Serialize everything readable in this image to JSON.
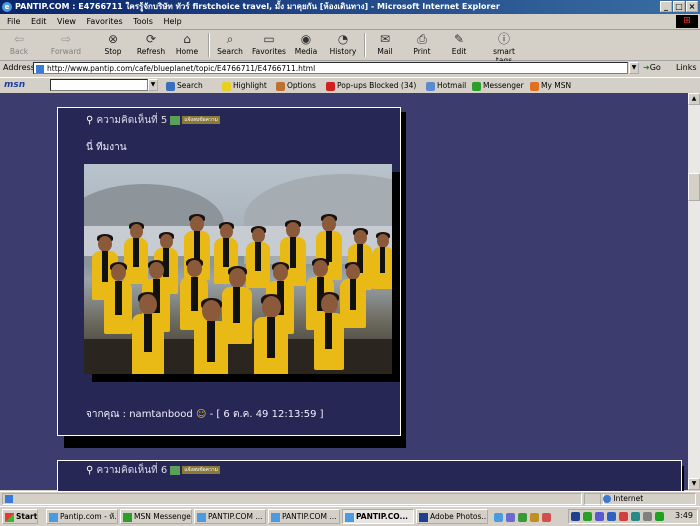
{
  "window": {
    "title": "PANTIP.COM : E4766711 ใครรู้จักบริษัท ทัวร์ firstchoice travel, มั้ง มาคุยกัน [ห้องเดินทาง] - Microsoft Internet Explorer"
  },
  "menu": [
    "File",
    "Edit",
    "View",
    "Favorites",
    "Tools",
    "Help"
  ],
  "toolbar": {
    "back": "Back",
    "forward": "Forward",
    "stop": "Stop",
    "refresh": "Refresh",
    "home": "Home",
    "search": "Search",
    "favorites": "Favorites",
    "media": "Media",
    "history": "History",
    "mail": "Mail",
    "print": "Print",
    "edit": "Edit",
    "smart_tags": "smart tags"
  },
  "address": {
    "label": "Address",
    "url": "http://www.pantip.com/cafe/blueplanet/topic/E4766711/E4766711.html",
    "go": "Go",
    "links": "Links"
  },
  "msn": {
    "logo": "msn",
    "search": "Search",
    "highlight": "Highlight",
    "options": "Options",
    "popups": "Pop-ups Blocked (34)",
    "hotmail": "Hotmail",
    "messenger": "Messenger",
    "my_msn": "My MSN"
  },
  "posts": [
    {
      "header": "ความคิดเห็นที่ 5",
      "badge": "แจ้งลบข้อความ",
      "text": "นี่   ทีมงาน",
      "footer": "จากคุณ : namtanbood",
      "emoticon": "☺",
      "date": "- [ 6 ต.ค. 49 12:13:59 ]"
    },
    {
      "header": "ความคิดเห็นที่ 6",
      "badge": "แจ้งลบข้อความ"
    }
  ],
  "status": {
    "zone": "Internet"
  },
  "taskbar": {
    "start": "Start",
    "tasks": [
      "Pantip.com - ห้...",
      "MSN Messenger",
      "PANTIP.COM ...",
      "PANTIP.COM ...",
      "PANTIP.CO...",
      "Adobe Photos..."
    ],
    "clock": "3:49"
  },
  "colors": {
    "content_bg": "#3c3c6e",
    "post_bg": "#272755",
    "titlebar": "#0a246a"
  }
}
